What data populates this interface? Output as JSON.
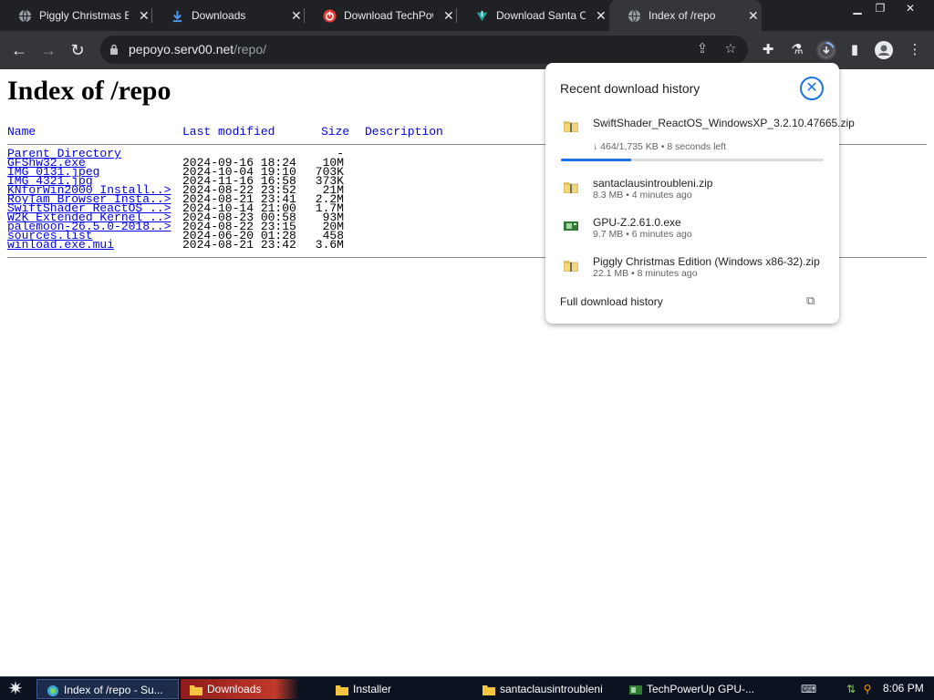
{
  "browser": {
    "tabs": [
      {
        "title": "Piggly Christmas Edi",
        "favicon": "globe-icon"
      },
      {
        "title": "Downloads",
        "favicon": "download-icon"
      },
      {
        "title": "Download TechPower",
        "favicon": "techpowerup-icon"
      },
      {
        "title": "Download Santa Cla",
        "favicon": "santa-download-icon"
      },
      {
        "title": "Index of /repo",
        "favicon": "globe-icon",
        "active": true
      }
    ],
    "window_controls": {
      "minimize": "▁",
      "restore": "❐",
      "close": "✕"
    },
    "url_host": "pepoyo.serv00.net",
    "url_path": "/repo/",
    "accent": "#1a73e8"
  },
  "page": {
    "heading": "Index of /repo",
    "columns": {
      "name": "Name",
      "modified": "Last modified",
      "size": "Size",
      "description": "Description"
    },
    "entries": [
      {
        "name": "Parent Directory",
        "modified": "",
        "size": "-"
      },
      {
        "name": "GFShw32.exe",
        "modified": "2024-09-16 18:24",
        "size": "10M"
      },
      {
        "name": "IMG_0131.jpeg",
        "modified": "2024-10-04 19:10",
        "size": "703K"
      },
      {
        "name": "IMG_4321.jpg",
        "modified": "2024-11-16 16:58",
        "size": "373K"
      },
      {
        "name": "KNforWin2000_Install..>",
        "modified": "2024-08-22 23:52",
        "size": "21M"
      },
      {
        "name": "RoyTam_Browser_Insta..>",
        "modified": "2024-08-21 23:41",
        "size": "2.2M"
      },
      {
        "name": "SwiftShader_ReactOS_..>",
        "modified": "2024-10-14 21:00",
        "size": "1.7M"
      },
      {
        "name": "W2K_Extended_Kernel_..>",
        "modified": "2024-08-23 00:58",
        "size": "93M"
      },
      {
        "name": "palemoon-26.5.0-2018..>",
        "modified": "2024-08-22 23:15",
        "size": "20M"
      },
      {
        "name": "sources.list",
        "modified": "2024-06-20 01:28",
        "size": "458"
      },
      {
        "name": "winload.exe.mui",
        "modified": "2024-08-21 23:42",
        "size": "3.6M"
      }
    ]
  },
  "downloads": {
    "title": "Recent download history",
    "items": [
      {
        "name": "SwiftShader_ReactOS_WindowsXP_3.2.10.47665.zip",
        "meta": "↓ 464/1,735 KB • 8 seconds left",
        "icon": "zip-folder-icon",
        "progress": 0.267
      },
      {
        "name": "santaclausintroubleni.zip",
        "meta": "8.3 MB • 4 minutes ago",
        "icon": "zip-folder-icon"
      },
      {
        "name": "GPU-Z.2.61.0.exe",
        "meta": "9.7 MB • 6 minutes ago",
        "icon": "gpu-icon"
      },
      {
        "name": "Piggly Christmas Edition (Windows x86-32).zip",
        "meta": "22.1 MB • 8 minutes ago",
        "icon": "zip-folder-icon"
      }
    ],
    "full_history": "Full download history"
  },
  "taskbar": {
    "buttons": [
      {
        "label": "Index of /repo - Su...",
        "icon": "browser-icon"
      },
      {
        "label": "Downloads",
        "icon": "folder-icon"
      },
      {
        "label": "Installer",
        "icon": "folder-icon"
      },
      {
        "label": "santaclausintroubleni",
        "icon": "folder-icon"
      },
      {
        "label": "TechPowerUp GPU-...",
        "icon": "gpu-icon"
      }
    ],
    "clock": "8:06 PM"
  }
}
